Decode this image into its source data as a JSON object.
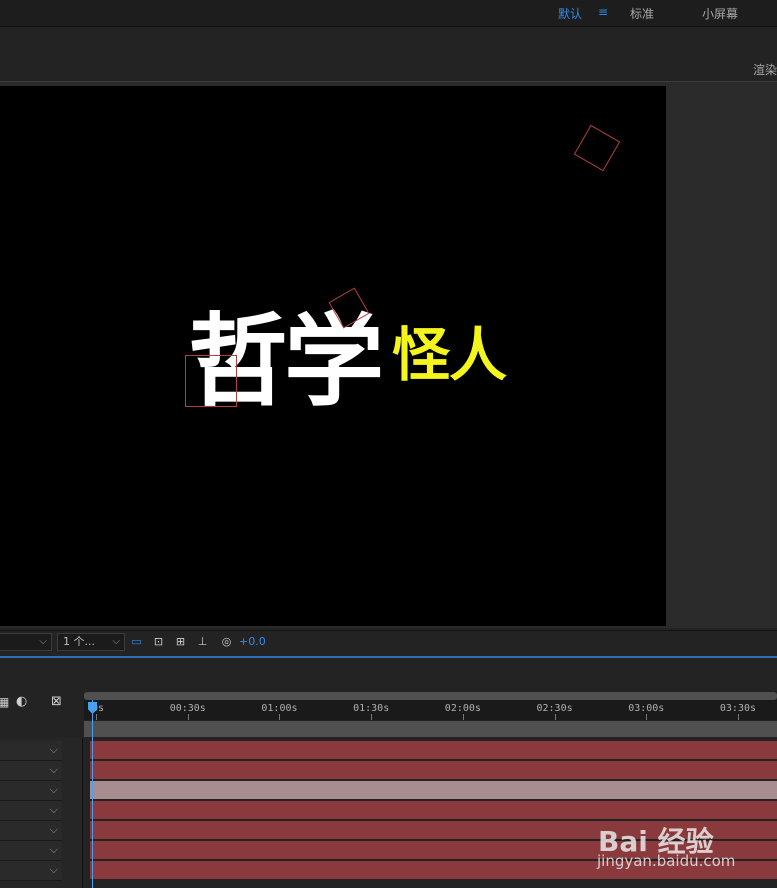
{
  "workspaces": {
    "default": "默认",
    "menu_glyph": "≡",
    "standard": "标准",
    "small_screen": "小屏幕"
  },
  "panels": {
    "render_tab": "渲染"
  },
  "composition": {
    "title_main": "哲学",
    "title_sub": "怪人",
    "colors": {
      "background": "#000000",
      "title_main": "#ffffff",
      "title_sub": "#f5f51e",
      "shape_stroke": "#b0403f"
    }
  },
  "viewer_toolbar": {
    "view_count": "1 个...",
    "exposure": "+0.0",
    "icons": [
      "region-of-interest-icon",
      "transparency-grid-icon",
      "3d-draft-icon",
      "flowchart-icon",
      "exposure-reset-icon"
    ]
  },
  "timeline": {
    "ruler_labels": [
      "0s",
      "00:30s",
      "01:00s",
      "01:30s",
      "02:00s",
      "02:30s",
      "03:00s",
      "03:30s"
    ],
    "layers": [
      {
        "color": "#8a3a3d"
      },
      {
        "color": "#8a3a3d"
      },
      {
        "color": "#a88d90"
      },
      {
        "color": "#8a3a3d"
      },
      {
        "color": "#8a3a3d"
      },
      {
        "color": "#8a3a3d"
      },
      {
        "color": "#8a3a3d"
      }
    ],
    "accent_color": "#2d8ceb"
  },
  "watermark": {
    "logo": "Bai 经验",
    "url": "jingyan.baidu.com"
  }
}
